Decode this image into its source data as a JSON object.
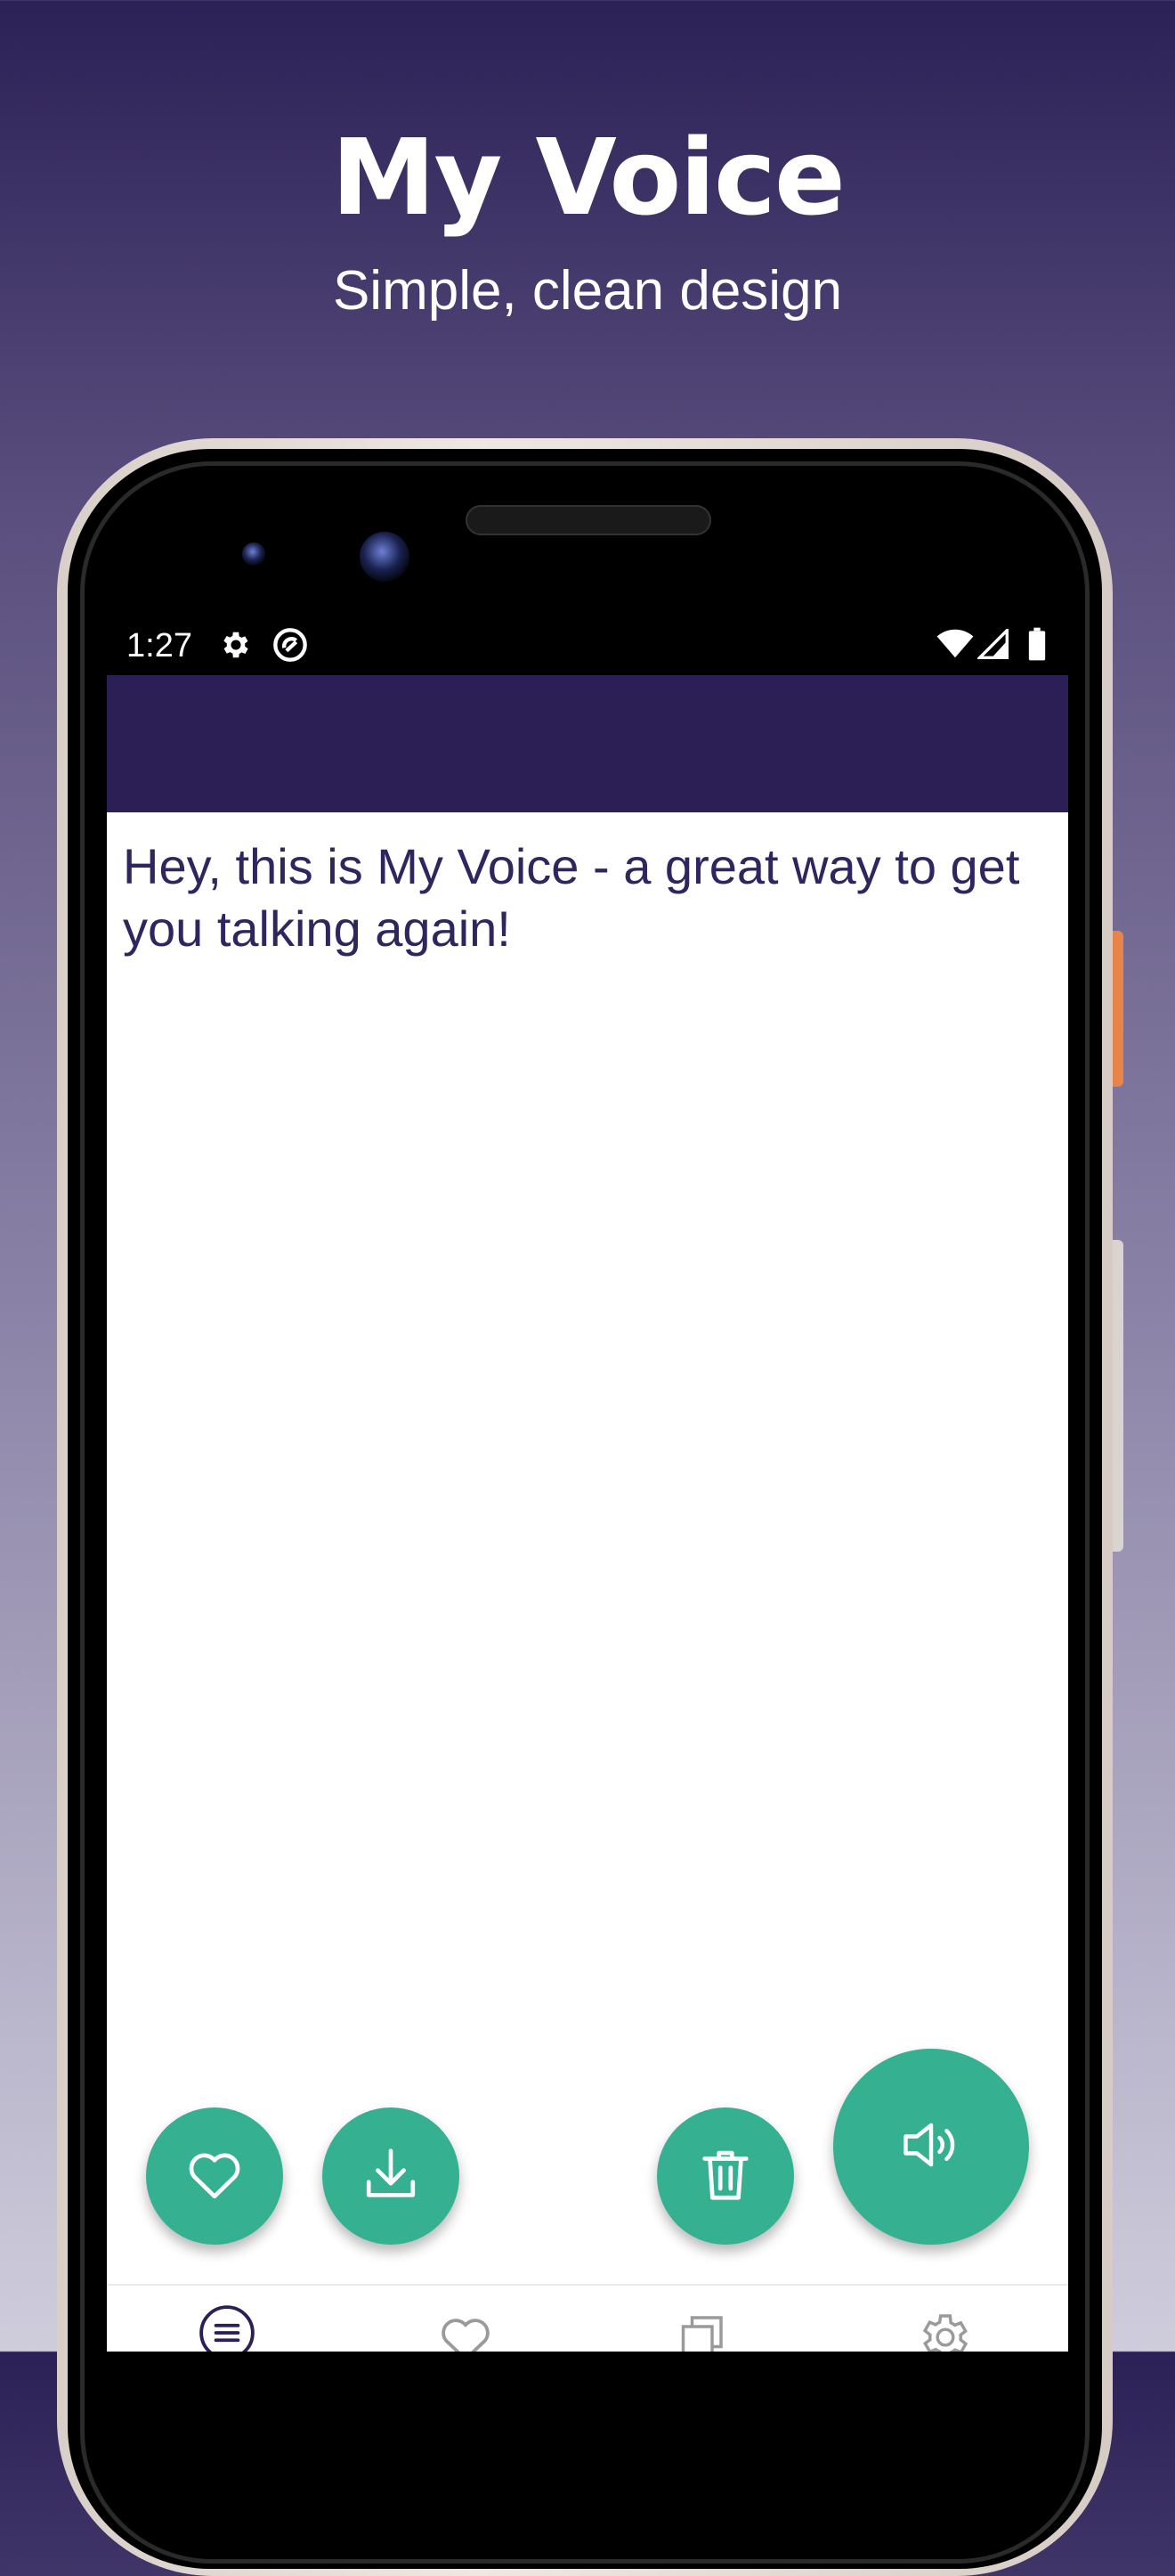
{
  "promo": {
    "title": "My Voice",
    "subtitle": "Simple, clean design"
  },
  "status_bar": {
    "time": "1:27",
    "icons": [
      "gear-icon",
      "sync-circle-icon",
      "wifi-icon",
      "cell-signal-icon",
      "battery-icon"
    ]
  },
  "main": {
    "speech_text": "Hey, this is My Voice - a great way to get you talking again!"
  },
  "actions": [
    "favorite-icon",
    "download-icon",
    "trash-icon",
    "speaker-icon"
  ],
  "bottom_nav": [
    "menu-list-icon",
    "heart-outline-icon",
    "copies-icon",
    "settings-icon"
  ],
  "colors": {
    "app_bar": "#2b1f56",
    "accent": "#35b192",
    "text": "#2f2660",
    "background_top": "#2c2156",
    "background_bottom": "#cfcddc"
  }
}
